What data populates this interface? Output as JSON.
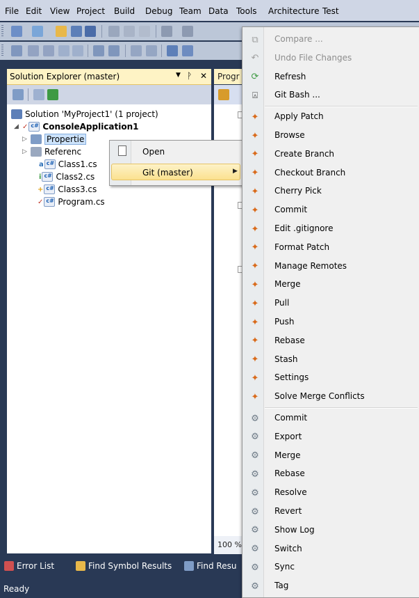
{
  "menubar": {
    "items": [
      "File",
      "Edit",
      "View",
      "Project",
      "Build",
      "Debug",
      "Team",
      "Data",
      "Tools",
      "Architecture",
      "Test"
    ]
  },
  "solution_explorer": {
    "title": "Solution Explorer (master)",
    "pin_glyph": "&#x1F4CC;",
    "close_glyph": "✕",
    "tree": [
      {
        "label": "Solution 'MyProject1' (1 project)",
        "level": 0
      },
      {
        "label": "ConsoleApplication1",
        "level": 1,
        "bold": true
      },
      {
        "label": "Propertie",
        "level": 2,
        "selected": true
      },
      {
        "label": "Referenc",
        "level": 2
      },
      {
        "label": "Class1.cs",
        "level": 2
      },
      {
        "label": "Class2.cs",
        "level": 2
      },
      {
        "label": "Class3.cs",
        "level": 2
      },
      {
        "label": "Program.cs",
        "level": 2
      }
    ]
  },
  "editor": {
    "tab_label": "Progr",
    "zoom": "100 %"
  },
  "context_menu_1": {
    "items": [
      "Open",
      "Git (master)"
    ]
  },
  "context_menu_2": {
    "group_top": [
      "Compare ...",
      "Undo File Changes",
      "Refresh",
      "Git Bash ..."
    ],
    "group_git": [
      "Apply Patch",
      "Browse",
      "Create Branch",
      "Checkout Branch",
      "Cherry Pick",
      "Commit",
      "Edit .gitignore",
      "Format Patch",
      "Manage Remotes",
      "Merge",
      "Pull",
      "Push",
      "Rebase",
      "Stash",
      "Settings",
      "Solve Merge Conflicts"
    ],
    "group_tortoise": [
      "Commit",
      "Export",
      "Merge",
      "Rebase",
      "Resolve",
      "Revert",
      "Show Log",
      "Switch",
      "Sync",
      "Tag"
    ]
  },
  "bottom_tabs": [
    "Error List",
    "Find Symbol Results",
    "Find Resu"
  ],
  "status": "Ready",
  "colors": {
    "chrome": "#293955",
    "menubar": "#cfd6e5",
    "header_active": "#fef3c5",
    "menu_bg": "#f0f0f0"
  }
}
